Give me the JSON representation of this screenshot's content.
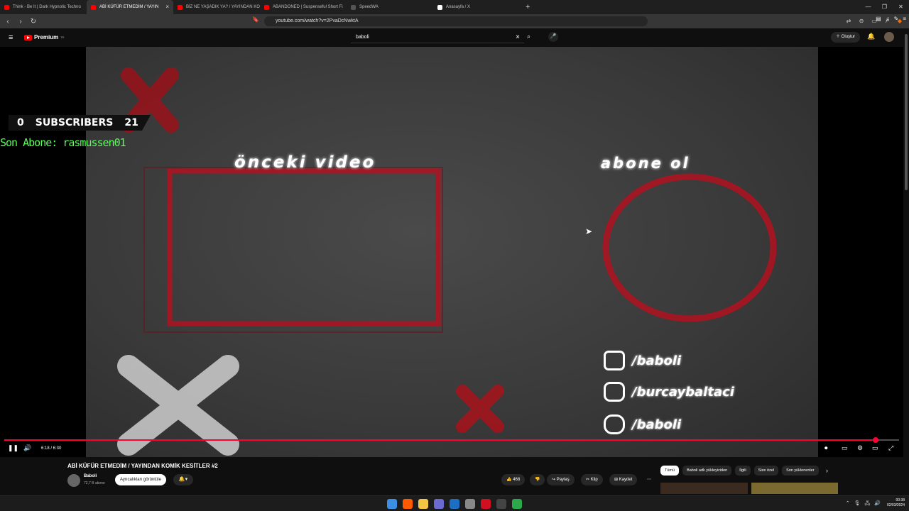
{
  "browser": {
    "tabs": [
      {
        "title": "Think - Be It | Dark Hypnotic Techno",
        "color": "#ff0000",
        "active": false
      },
      {
        "title": "ABİ KÜFÜR ETMEDİM / YAYIN",
        "color": "#ff0000",
        "active": true
      },
      {
        "title": "BİZ NE YAŞADIK YA? / YAYINDAN KO",
        "color": "#ff0000",
        "active": false
      },
      {
        "title": "ABANDONED | Suspenseful Short Fi",
        "color": "#ff0000",
        "active": false
      },
      {
        "title": "SpeedWA",
        "color": "#555555",
        "active": false
      },
      {
        "title": "Anasayfa / X",
        "color": "#ffffff",
        "active": false
      }
    ],
    "url": "youtube.com/watch?v=2PvaDcNwktA"
  },
  "youtube": {
    "logo_text": "Premium",
    "logo_sup": "TR",
    "search_value": "baboli",
    "create_label": "Oluştur"
  },
  "overlay": {
    "subs_left": "0",
    "subs_label": "SUBSCRIBERS",
    "subs_right": "21",
    "last_sub": "Son Abone: rasmussen01",
    "prev_video": "önceki video",
    "subscribe": "abone ol",
    "social": [
      "/baboli",
      "/burcaybaltaci",
      "/baboli"
    ]
  },
  "player": {
    "time": "6:18 / 6:30",
    "progress": 0.97
  },
  "video": {
    "title": "ABİ KÜFÜR ETMEDİM / YAYINDAN KOMİK KESİTLER #2",
    "channel": "Baboli",
    "subscribers": "72,7 B abone",
    "join_label": "Ayrıcalıkları görüntüle",
    "likes": "468",
    "share": "Paylaş",
    "clip": "Klip",
    "save": "Kaydet"
  },
  "chips": [
    "Tümü",
    "Baboli adlı yükleyiciden",
    "İlgili",
    "Size özel",
    "Son yüklenenler"
  ],
  "clock": {
    "time": "00:38",
    "date": "02/03/2024"
  }
}
